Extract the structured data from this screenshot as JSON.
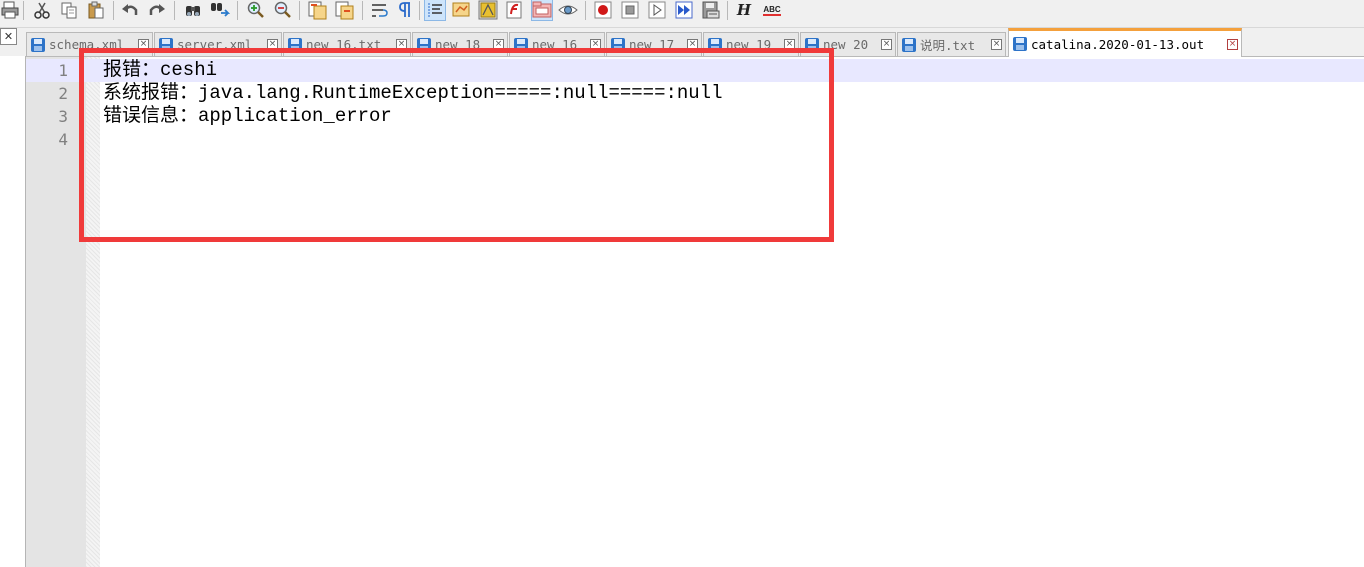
{
  "toolbar": {
    "buttons": [
      {
        "icon": "print-icon"
      },
      {
        "icon": "cut-icon"
      },
      {
        "icon": "copy-icon"
      },
      {
        "icon": "paste-icon"
      },
      {
        "icon": "undo-icon"
      },
      {
        "icon": "redo-icon"
      },
      {
        "icon": "find-icon"
      },
      {
        "icon": "replace-icon"
      },
      {
        "icon": "zoom-in-icon"
      },
      {
        "icon": "zoom-out-icon"
      },
      {
        "icon": "sync-vertical-icon"
      },
      {
        "icon": "sync-horizontal-icon"
      },
      {
        "icon": "word-wrap-icon"
      },
      {
        "icon": "show-all-characters-icon"
      },
      {
        "icon": "indent-guide-icon"
      },
      {
        "icon": "document-map-icon"
      },
      {
        "icon": "function-list-icon"
      },
      {
        "icon": "folder-workspace-icon"
      },
      {
        "icon": "monitoring-icon"
      },
      {
        "icon": "record-macro-icon"
      },
      {
        "icon": "stop-macro-icon"
      },
      {
        "icon": "play-macro-icon"
      },
      {
        "icon": "run-macro-multiple-icon"
      },
      {
        "icon": "save-macro-icon"
      },
      {
        "icon": "heading-icon"
      },
      {
        "icon": "spell-check-icon"
      }
    ],
    "heading_glyph": "H",
    "spell_check_glyph": "ABC"
  },
  "tabs": [
    {
      "label": "schema.xml",
      "active": false
    },
    {
      "label": "server.xml",
      "active": false
    },
    {
      "label": "new 16.txt",
      "active": false
    },
    {
      "label": "new 18",
      "active": false
    },
    {
      "label": "new 16",
      "active": false
    },
    {
      "label": "new 17",
      "active": false
    },
    {
      "label": "new 19",
      "active": false
    },
    {
      "label": "new 20",
      "active": false
    },
    {
      "label": "说明.txt",
      "active": false
    },
    {
      "label": "catalina.2020-01-13.out",
      "active": true
    }
  ],
  "editor": {
    "line_numbers": [
      "1",
      "2",
      "3",
      "4"
    ],
    "lines": [
      "报错：ceshi",
      "系统报错：java.lang.RuntimeException=====:null=====:null",
      "错误信息：application_error",
      ""
    ],
    "current_line": 1
  },
  "colors": {
    "highlight_box": "#f03a3a",
    "active_tab_accent": "#f4a03c",
    "current_line_bg": "#e8e8ff"
  }
}
